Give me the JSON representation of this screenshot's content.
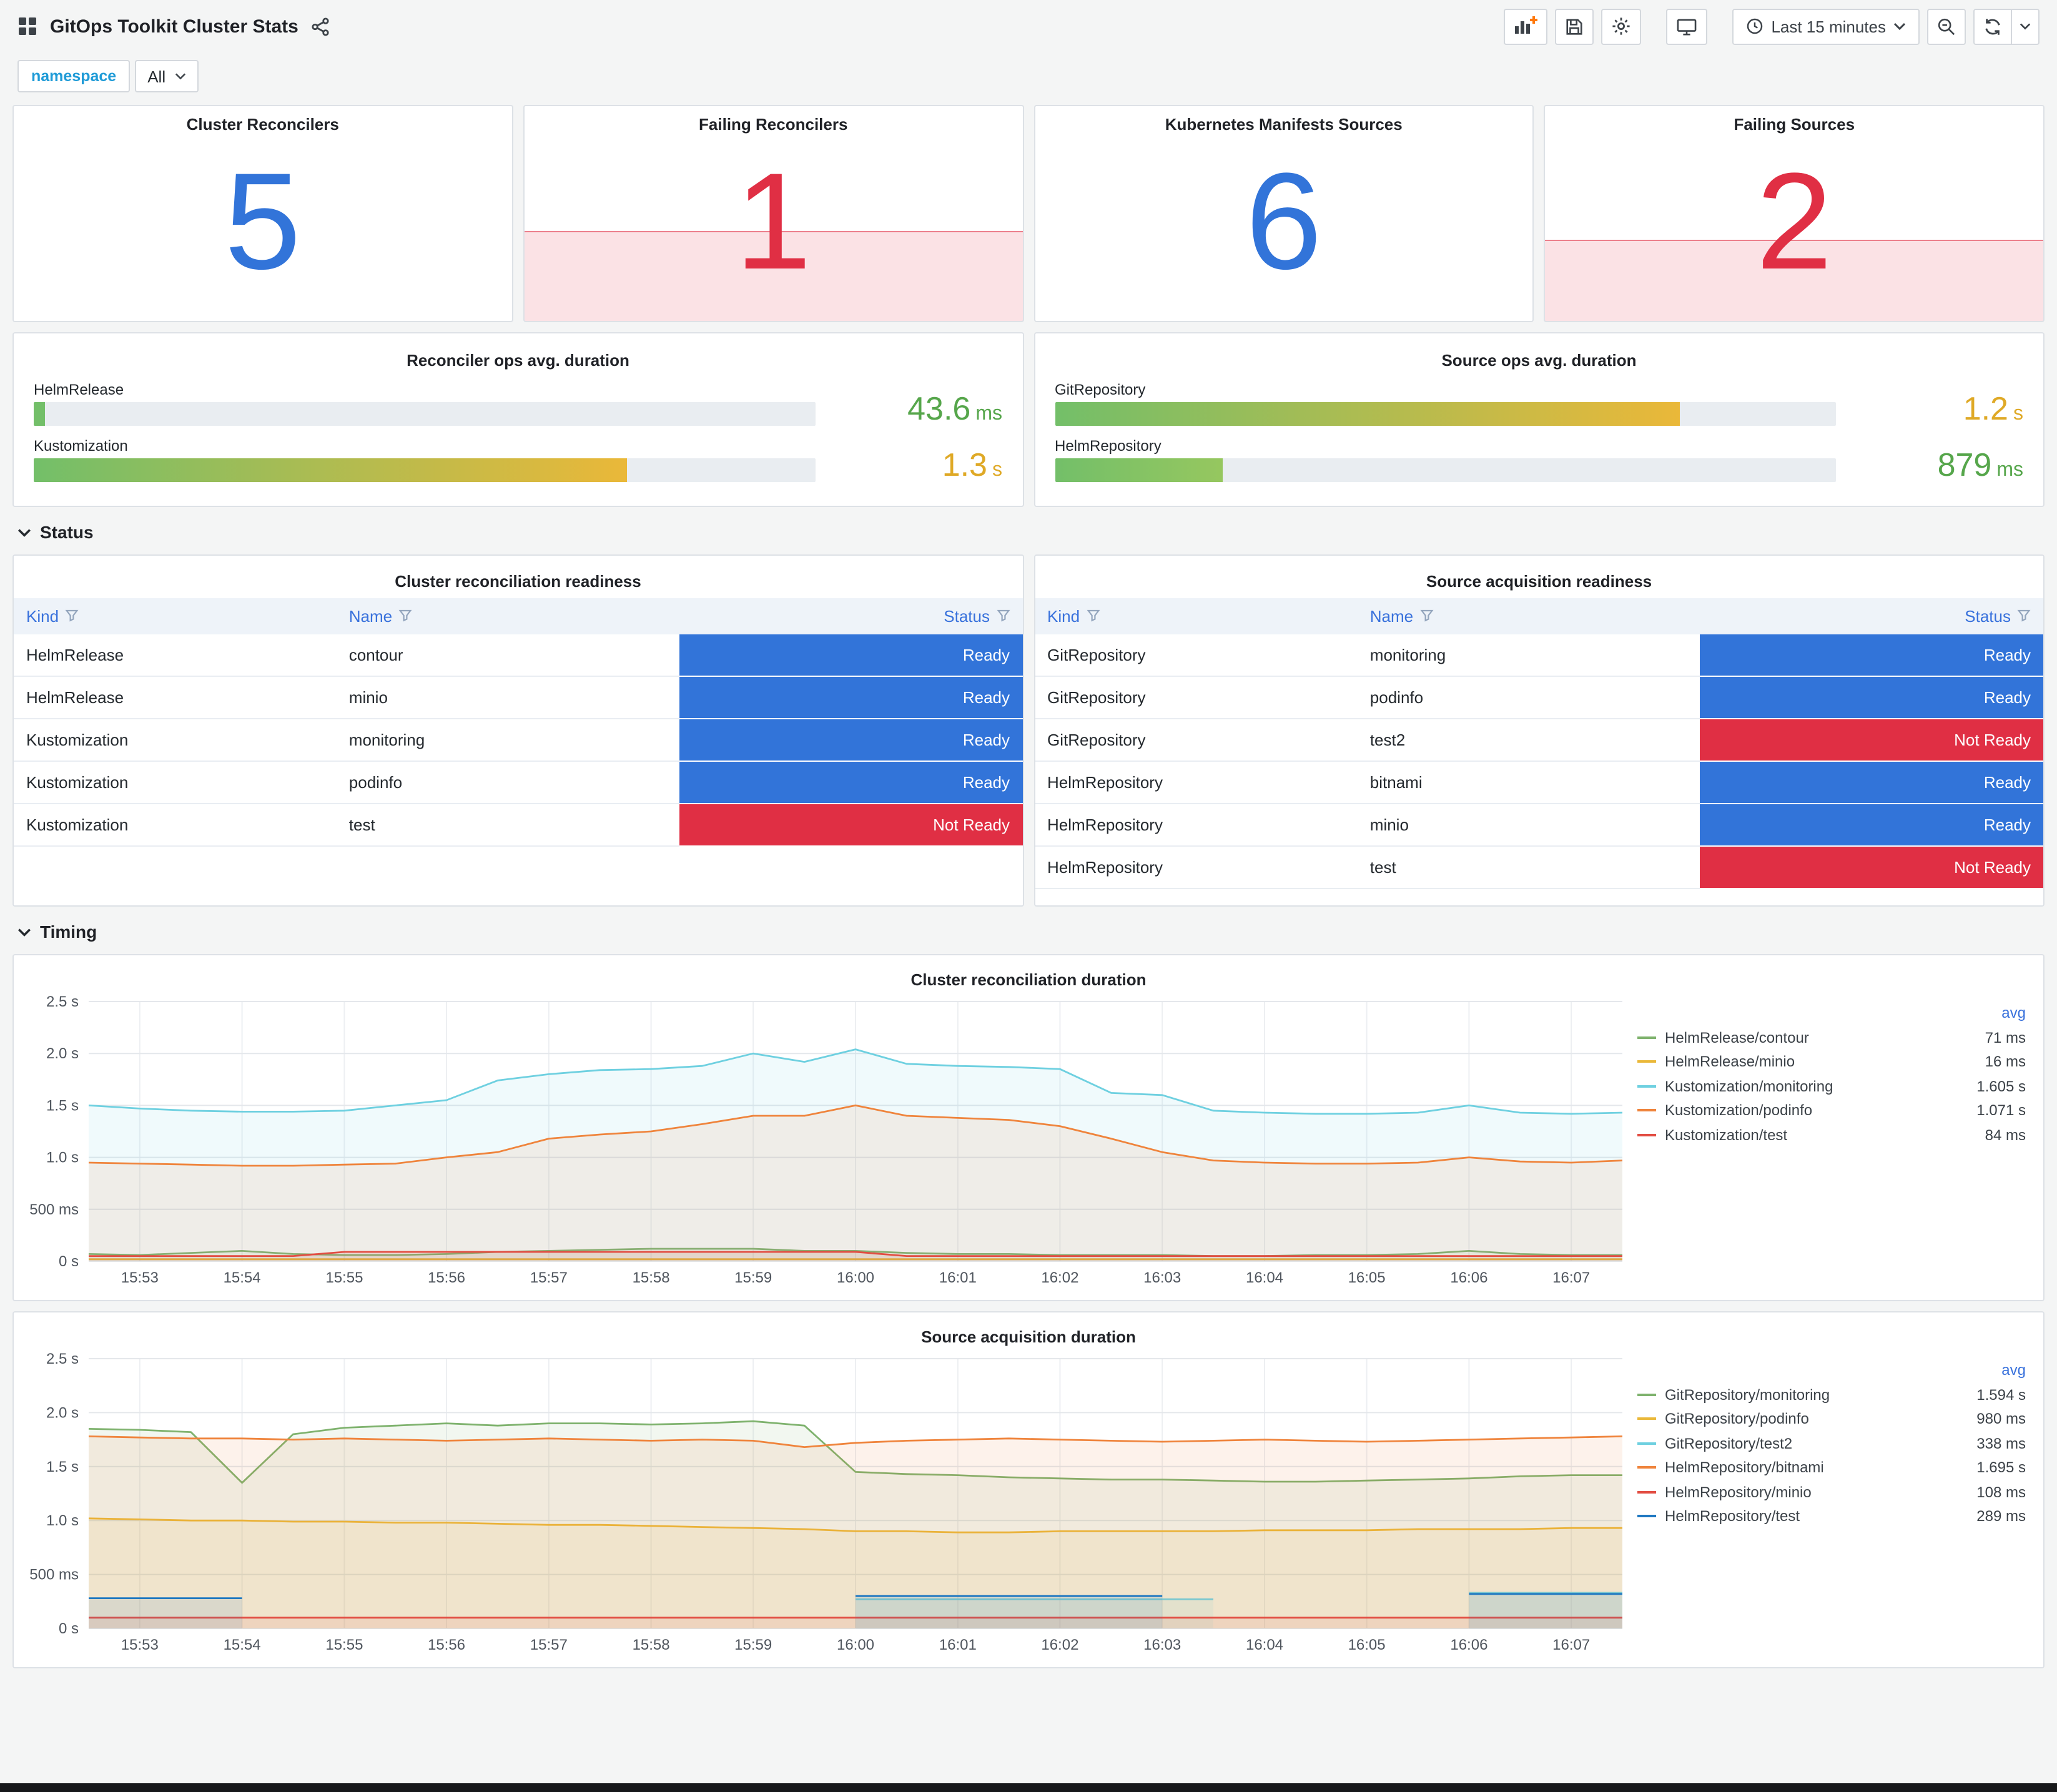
{
  "header": {
    "title": "GitOps Toolkit Cluster Stats",
    "time_picker": "Last 15 minutes"
  },
  "toolbar": {
    "icons": [
      "add-panel",
      "save-dashboard",
      "dashboard-settings",
      "cycle-view-mode",
      "clock",
      "zoom-out",
      "refresh",
      "refresh-interval-caret",
      "share",
      "dashboard-grid"
    ]
  },
  "variables": {
    "namespace_label": "namespace",
    "namespace_value": "All"
  },
  "colors": {
    "ok_blue": "#3274d9",
    "alert_red": "#e02f44",
    "ready_blue": "#3274d9",
    "not_ready_red": "#e02f44",
    "green_text": "#56a64b",
    "amber_text": "#dfa926",
    "variable_label": "#1f9bd7",
    "legend_avg_header": "#3871dc"
  },
  "sections": {
    "status": "Status",
    "timing": "Timing"
  },
  "stat_panels": [
    {
      "title": "Cluster Reconcilers",
      "value": "5",
      "state": "ok",
      "fill_percent": 0
    },
    {
      "title": "Failing Reconcilers",
      "value": "1",
      "state": "alert",
      "fill_percent": 42
    },
    {
      "title": "Kubernetes Manifests Sources",
      "value": "6",
      "state": "ok",
      "fill_percent": 0
    },
    {
      "title": "Failing Sources",
      "value": "2",
      "state": "alert",
      "fill_percent": 38
    }
  ],
  "gauge_panels": [
    {
      "title": "Reconciler ops avg. duration",
      "rows": [
        {
          "label": "HelmRelease",
          "percent": 1.5,
          "value": "43.6",
          "unit": "ms",
          "value_color": "#56a64b",
          "bar_from": "#73bf69",
          "bar_to": "#73bf69"
        },
        {
          "label": "Kustomization",
          "percent": 76,
          "value": "1.3",
          "unit": "s",
          "value_color": "#dfa926",
          "bar_from": "#73bf69",
          "bar_to": "#eab839"
        }
      ]
    },
    {
      "title": "Source ops avg. duration",
      "rows": [
        {
          "label": "GitRepository",
          "percent": 80,
          "value": "1.2",
          "unit": "s",
          "value_color": "#dfa926",
          "bar_from": "#73bf69",
          "bar_to": "#eab839"
        },
        {
          "label": "HelmRepository",
          "percent": 21.5,
          "value": "879",
          "unit": "ms",
          "value_color": "#56a64b",
          "bar_from": "#73bf69",
          "bar_to": "#96c75f"
        }
      ]
    }
  ],
  "tables": [
    {
      "title": "Cluster reconciliation readiness",
      "columns": [
        "Kind",
        "Name",
        "Status"
      ],
      "rows": [
        [
          "HelmRelease",
          "contour",
          "Ready"
        ],
        [
          "HelmRelease",
          "minio",
          "Ready"
        ],
        [
          "Kustomization",
          "monitoring",
          "Ready"
        ],
        [
          "Kustomization",
          "podinfo",
          "Ready"
        ],
        [
          "Kustomization",
          "test",
          "Not Ready"
        ]
      ]
    },
    {
      "title": "Source acquisition readiness",
      "columns": [
        "Kind",
        "Name",
        "Status"
      ],
      "rows": [
        [
          "GitRepository",
          "monitoring",
          "Ready"
        ],
        [
          "GitRepository",
          "podinfo",
          "Ready"
        ],
        [
          "GitRepository",
          "test2",
          "Not Ready"
        ],
        [
          "HelmRepository",
          "bitnami",
          "Ready"
        ],
        [
          "HelmRepository",
          "minio",
          "Ready"
        ],
        [
          "HelmRepository",
          "test",
          "Not Ready"
        ]
      ]
    }
  ],
  "chart_data": [
    {
      "type": "line",
      "title": "Cluster reconciliation duration",
      "ylim": [
        0,
        2.5
      ],
      "y_tick_values": [
        0,
        0.5,
        1.0,
        1.5,
        2.0,
        2.5
      ],
      "y_ticks": [
        "0 s",
        "500 ms",
        "1.0 s",
        "1.5 s",
        "2.0 s",
        "2.5 s"
      ],
      "x_ticks": [
        "15:53",
        "15:54",
        "15:55",
        "15:56",
        "15:57",
        "15:58",
        "15:59",
        "16:00",
        "16:01",
        "16:02",
        "16:03",
        "16:04",
        "16:05",
        "16:06",
        "16:07"
      ],
      "x_tick_indices": [
        1,
        3,
        5,
        7,
        9,
        11,
        13,
        15,
        17,
        19,
        21,
        23,
        25,
        27,
        29
      ],
      "grid": true,
      "legend_position": "right",
      "legend_header": "avg",
      "series": [
        {
          "name": "HelmRelease/contour",
          "color": "#7EB26D",
          "avg": "71 ms",
          "values": [
            0.07,
            0.06,
            0.08,
            0.1,
            0.07,
            0.06,
            0.06,
            0.07,
            0.09,
            0.1,
            0.11,
            0.12,
            0.12,
            0.12,
            0.1,
            0.1,
            0.08,
            0.07,
            0.07,
            0.06,
            0.06,
            0.06,
            0.05,
            0.05,
            0.06,
            0.06,
            0.07,
            0.1,
            0.07,
            0.06,
            0.06
          ]
        },
        {
          "name": "HelmRelease/minio",
          "color": "#EAB839",
          "avg": "16 ms",
          "values": [
            0.02,
            0.02,
            0.02,
            0.02,
            0.02,
            0.02,
            0.02,
            0.02,
            0.02,
            0.02,
            0.02,
            0.02,
            0.02,
            0.02,
            0.02,
            0.02,
            0.02,
            0.02,
            0.02,
            0.02,
            0.02,
            0.02,
            0.02,
            0.02,
            0.02,
            0.02,
            0.02,
            0.02,
            0.02,
            0.02,
            0.02
          ]
        },
        {
          "name": "Kustomization/monitoring",
          "color": "#6ED0E0",
          "avg": "1.605 s",
          "values": [
            1.5,
            1.47,
            1.45,
            1.44,
            1.44,
            1.45,
            1.5,
            1.55,
            1.74,
            1.8,
            1.84,
            1.85,
            1.88,
            2.0,
            1.92,
            2.04,
            1.9,
            1.88,
            1.87,
            1.85,
            1.62,
            1.6,
            1.45,
            1.43,
            1.42,
            1.42,
            1.43,
            1.5,
            1.43,
            1.42,
            1.43
          ]
        },
        {
          "name": "Kustomization/podinfo",
          "color": "#EF843C",
          "avg": "1.071 s",
          "values": [
            0.95,
            0.94,
            0.93,
            0.92,
            0.92,
            0.93,
            0.94,
            1.0,
            1.05,
            1.18,
            1.22,
            1.25,
            1.32,
            1.4,
            1.4,
            1.5,
            1.4,
            1.38,
            1.36,
            1.3,
            1.18,
            1.05,
            0.97,
            0.95,
            0.94,
            0.94,
            0.95,
            1.0,
            0.96,
            0.95,
            0.97
          ]
        },
        {
          "name": "Kustomization/test",
          "color": "#E24D42",
          "avg": "84 ms",
          "values": [
            0.05,
            0.05,
            0.05,
            0.05,
            0.05,
            0.09,
            0.09,
            0.09,
            0.09,
            0.09,
            0.09,
            0.09,
            0.09,
            0.09,
            0.09,
            0.09,
            0.05,
            0.05,
            0.05,
            0.05,
            0.05,
            0.05,
            0.05,
            0.05,
            0.05,
            0.05,
            0.05,
            0.05,
            0.05,
            0.05,
            0.05
          ]
        }
      ]
    },
    {
      "type": "line",
      "title": "Source acquisition duration",
      "ylim": [
        0,
        2.5
      ],
      "y_tick_values": [
        0,
        0.5,
        1.0,
        1.5,
        2.0,
        2.5
      ],
      "y_ticks": [
        "0 s",
        "500 ms",
        "1.0 s",
        "1.5 s",
        "2.0 s",
        "2.5 s"
      ],
      "x_ticks": [
        "15:53",
        "15:54",
        "15:55",
        "15:56",
        "15:57",
        "15:58",
        "15:59",
        "16:00",
        "16:01",
        "16:02",
        "16:03",
        "16:04",
        "16:05",
        "16:06",
        "16:07"
      ],
      "x_tick_indices": [
        1,
        3,
        5,
        7,
        9,
        11,
        13,
        15,
        17,
        19,
        21,
        23,
        25,
        27,
        29
      ],
      "grid": true,
      "legend_position": "right",
      "legend_header": "avg",
      "series": [
        {
          "name": "GitRepository/monitoring",
          "color": "#7EB26D",
          "avg": "1.594 s",
          "values": [
            1.85,
            1.84,
            1.82,
            1.35,
            1.8,
            1.86,
            1.88,
            1.9,
            1.88,
            1.9,
            1.9,
            1.89,
            1.9,
            1.92,
            1.88,
            1.45,
            1.43,
            1.42,
            1.4,
            1.39,
            1.38,
            1.38,
            1.37,
            1.36,
            1.36,
            1.37,
            1.38,
            1.39,
            1.41,
            1.42,
            1.42
          ]
        },
        {
          "name": "GitRepository/podinfo",
          "color": "#EAB839",
          "avg": "980 ms",
          "values": [
            1.02,
            1.01,
            1.0,
            1.0,
            0.99,
            0.99,
            0.98,
            0.98,
            0.97,
            0.96,
            0.96,
            0.95,
            0.94,
            0.93,
            0.92,
            0.9,
            0.9,
            0.89,
            0.89,
            0.9,
            0.9,
            0.9,
            0.9,
            0.91,
            0.91,
            0.91,
            0.92,
            0.92,
            0.92,
            0.93,
            0.93
          ]
        },
        {
          "name": "GitRepository/test2",
          "color": "#6ED0E0",
          "avg": "338 ms",
          "values": [
            null,
            null,
            null,
            null,
            null,
            null,
            null,
            null,
            null,
            null,
            null,
            null,
            null,
            null,
            null,
            0.27,
            0.27,
            0.27,
            0.27,
            0.27,
            0.27,
            0.27,
            0.27,
            null,
            null,
            null,
            null,
            0.33,
            0.33,
            0.33,
            0.33
          ]
        },
        {
          "name": "HelmRepository/bitnami",
          "color": "#EF843C",
          "avg": "1.695 s",
          "values": [
            1.78,
            1.77,
            1.76,
            1.76,
            1.75,
            1.76,
            1.75,
            1.74,
            1.75,
            1.76,
            1.75,
            1.74,
            1.75,
            1.74,
            1.68,
            1.72,
            1.74,
            1.75,
            1.76,
            1.75,
            1.74,
            1.73,
            1.74,
            1.75,
            1.74,
            1.73,
            1.74,
            1.75,
            1.76,
            1.77,
            1.78
          ]
        },
        {
          "name": "HelmRepository/minio",
          "color": "#E24D42",
          "avg": "108 ms",
          "values": [
            0.1,
            0.1,
            0.1,
            0.1,
            0.1,
            0.1,
            0.1,
            0.1,
            0.1,
            0.1,
            0.1,
            0.1,
            0.1,
            0.1,
            0.1,
            0.1,
            0.1,
            0.1,
            0.1,
            0.1,
            0.1,
            0.1,
            0.1,
            0.1,
            0.1,
            0.1,
            0.1,
            0.1,
            0.1,
            0.1,
            0.1
          ]
        },
        {
          "name": "HelmRepository/test",
          "color": "#1F78C1",
          "avg": "289 ms",
          "values": [
            0.28,
            0.28,
            0.28,
            0.28,
            null,
            null,
            null,
            null,
            null,
            null,
            null,
            null,
            null,
            null,
            null,
            0.3,
            0.3,
            0.3,
            0.3,
            0.3,
            0.3,
            0.3,
            null,
            null,
            null,
            null,
            null,
            0.32,
            0.32,
            0.32,
            0.32
          ]
        }
      ]
    }
  ]
}
